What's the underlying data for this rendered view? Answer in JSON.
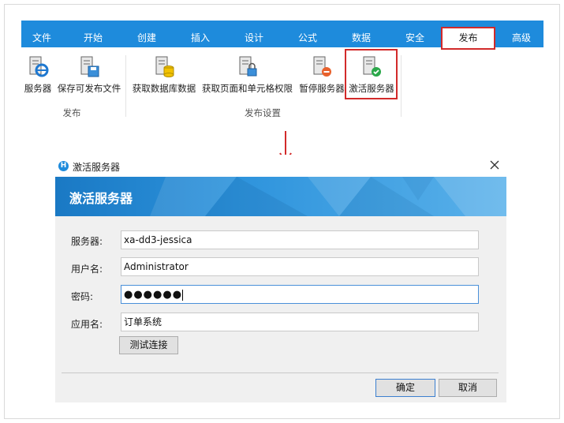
{
  "ribbon": {
    "tabs": [
      "文件",
      "开始",
      "创建",
      "插入",
      "设计",
      "公式",
      "数据",
      "安全",
      "发布",
      "高级"
    ],
    "active_tab": "发布",
    "buttons": [
      {
        "label": "服务器",
        "icon": "server-ie-icon"
      },
      {
        "label": "保存可发布文件",
        "icon": "save-publish-icon"
      },
      {
        "label": "获取数据库数据",
        "icon": "get-db-data-icon"
      },
      {
        "label": "获取页面和单元格权限",
        "icon": "get-permission-icon"
      },
      {
        "label": "暂停服务器",
        "icon": "pause-server-icon"
      },
      {
        "label": "激活服务器",
        "icon": "activate-server-icon"
      }
    ],
    "groups": [
      "发布",
      "发布设置"
    ]
  },
  "dialog": {
    "window_title": "激活服务器",
    "banner_title": "激活服务器",
    "fields": [
      {
        "label": "服务器:",
        "value": "xa-dd3-jessica"
      },
      {
        "label": "用户名:",
        "value": "Administrator"
      },
      {
        "label": "密码:",
        "value": "●●●●●●"
      },
      {
        "label": "应用名:",
        "value": "订单系统"
      }
    ],
    "test_button": "测试连接",
    "ok_button": "确定",
    "cancel_button": "取消"
  },
  "colors": {
    "ribbon_blue": "#1e8bdc",
    "highlight_red": "#d22a2a",
    "banner_blue": "#2d93dc"
  }
}
